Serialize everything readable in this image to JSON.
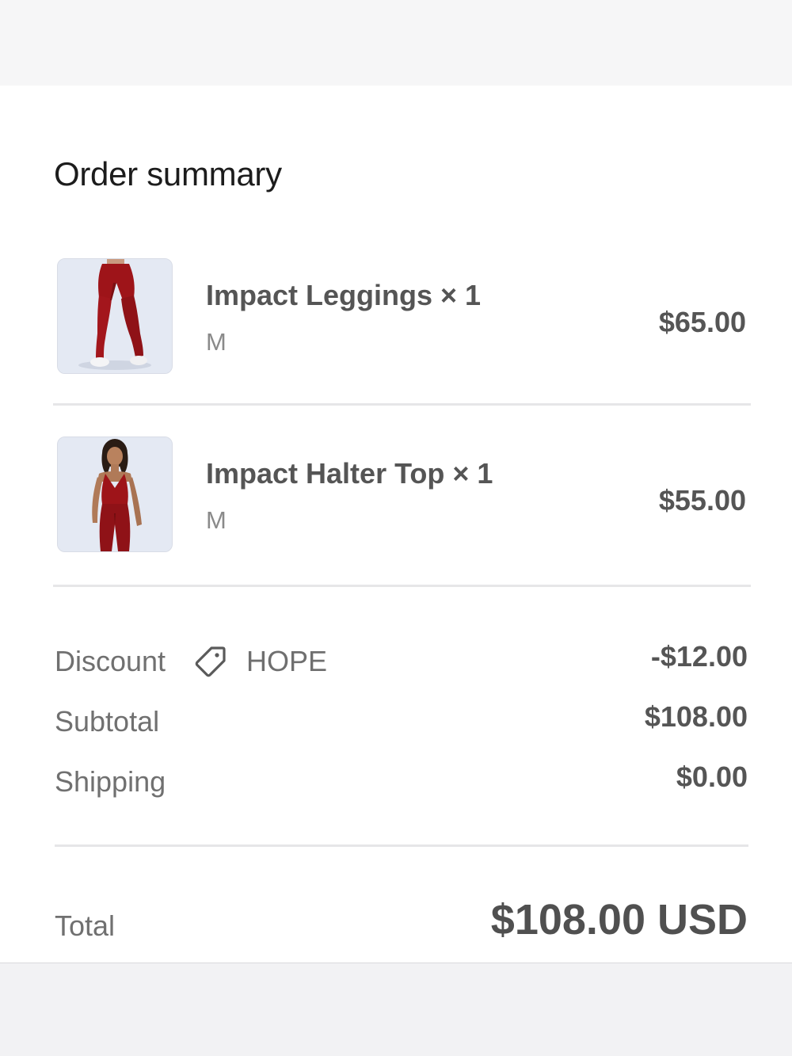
{
  "summary": {
    "title": "Order summary"
  },
  "items": [
    {
      "name": "Impact Leggings × 1",
      "variant": "M",
      "price": "$65.00",
      "image_icon": "leggings-product-image"
    },
    {
      "name": "Impact Halter Top × 1",
      "variant": "M",
      "price": "$55.00",
      "image_icon": "halter-top-product-image"
    }
  ],
  "discount": {
    "label": "Discount",
    "code": "HOPE",
    "amount": "-$12.00",
    "icon": "tag-icon"
  },
  "subtotal": {
    "label": "Subtotal",
    "amount": "$108.00"
  },
  "shipping": {
    "label": "Shipping",
    "amount": "$0.00"
  },
  "total": {
    "label": "Total",
    "amount": "$108.00 USD"
  },
  "colors": {
    "product_red": "#9e1419",
    "thumb_bg": "#e3e8f2",
    "text_primary": "#555555",
    "text_muted": "#707070"
  }
}
